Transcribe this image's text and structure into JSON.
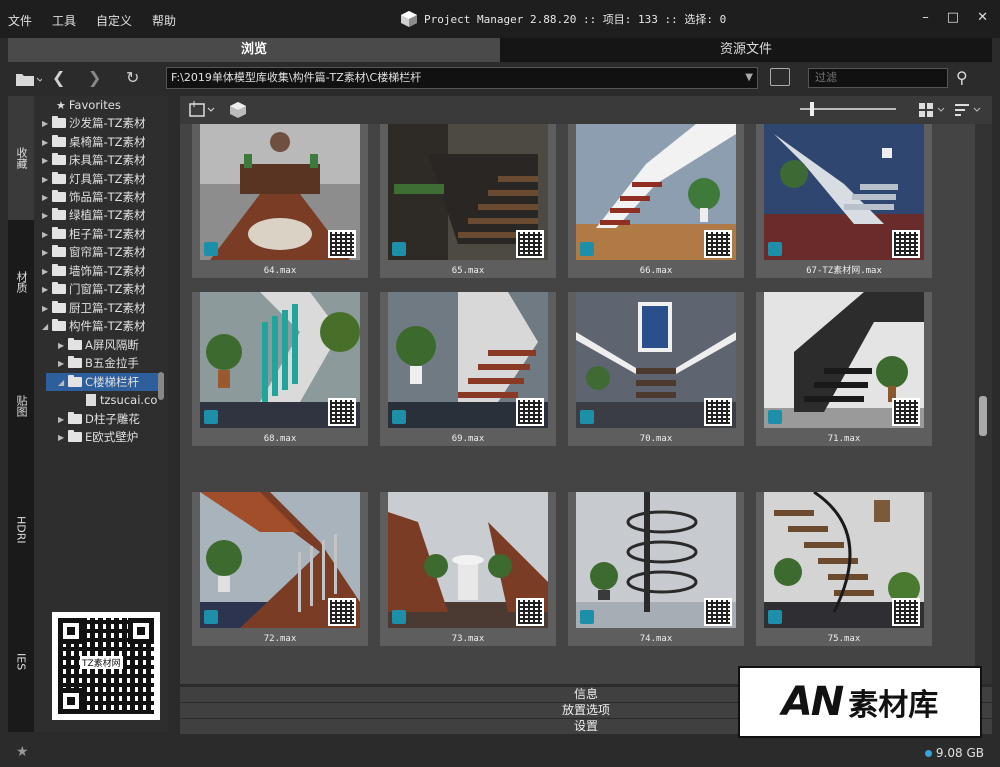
{
  "menu": [
    "文件",
    "工具",
    "自定义",
    "帮助"
  ],
  "app": {
    "title": "Project Manager 2.88.20  :: 项目: 133  :: 选择: 0"
  },
  "window_controls": {
    "minimize": "–",
    "maximize": "□",
    "close": "✕"
  },
  "tabs": [
    {
      "label": "浏览",
      "active": true
    },
    {
      "label": "资源文件",
      "active": false
    }
  ],
  "toolbar": {
    "path": "F:\\2019单体模型库收集\\构件篇-TZ素材\\C楼梯栏杆",
    "filter_placeholder": "过滤"
  },
  "left_tabs": [
    "收藏",
    "材质",
    "贴图",
    "HDRI",
    "IES"
  ],
  "tree": [
    {
      "label": "Favorites",
      "type": "favorites",
      "level": 0
    },
    {
      "label": "沙发篇-TZ素材",
      "type": "folder",
      "level": 0
    },
    {
      "label": "桌椅篇-TZ素材",
      "type": "folder",
      "level": 0
    },
    {
      "label": "床具篇-TZ素材",
      "type": "folder",
      "level": 0
    },
    {
      "label": "灯具篇-TZ素材",
      "type": "folder",
      "level": 0
    },
    {
      "label": "饰品篇-TZ素材",
      "type": "folder",
      "level": 0
    },
    {
      "label": "绿植篇-TZ素材",
      "type": "folder",
      "level": 0
    },
    {
      "label": "柜子篇-TZ素材",
      "type": "folder",
      "level": 0
    },
    {
      "label": "窗帘篇-TZ素材",
      "type": "folder",
      "level": 0
    },
    {
      "label": "墙饰篇-TZ素材",
      "type": "folder",
      "level": 0
    },
    {
      "label": "门窗篇-TZ素材",
      "type": "folder",
      "level": 0
    },
    {
      "label": "厨卫篇-TZ素材",
      "type": "folder",
      "level": 0
    },
    {
      "label": "构件篇-TZ素材",
      "type": "folder",
      "level": 0,
      "expanded": true
    },
    {
      "label": "A屏风隔断",
      "type": "folder",
      "level": 1
    },
    {
      "label": "B五金拉手",
      "type": "folder",
      "level": 1
    },
    {
      "label": "C楼梯栏杆",
      "type": "folder",
      "level": 1,
      "selected": true,
      "expanded": true
    },
    {
      "label": "tzsucai.co",
      "type": "file",
      "level": 2
    },
    {
      "label": "D柱子雕花",
      "type": "folder",
      "level": 1
    },
    {
      "label": "E欧式壁炉",
      "type": "folder",
      "level": 1
    }
  ],
  "qr_caption": "TZ素材网",
  "grid": {
    "items": [
      {
        "label": "64.max",
        "scene": "brick"
      },
      {
        "label": "65.max",
        "scene": "dark"
      },
      {
        "label": "66.max",
        "scene": "white"
      },
      {
        "label": "67-TZ素材网.max",
        "scene": "blue"
      },
      {
        "label": "68.max",
        "scene": "teal"
      },
      {
        "label": "69.max",
        "scene": "wood"
      },
      {
        "label": "70.max",
        "scene": "grey"
      },
      {
        "label": "71.max",
        "scene": "blackrail"
      },
      {
        "label": "72.max",
        "scene": "wood2"
      },
      {
        "label": "73.max",
        "scene": "fountain"
      },
      {
        "label": "74.max",
        "scene": "spiral"
      },
      {
        "label": "75.max",
        "scene": "curved"
      }
    ]
  },
  "panels": [
    "信息",
    "放置选项",
    "设置"
  ],
  "watermark": {
    "prefix": "AN",
    "text": "素材库"
  },
  "status": {
    "disk": "9.08 GB"
  },
  "colors": {
    "selection": "#2e5f9c",
    "max_icon": "#1e8fa8",
    "disk_dot": "#36a3d9"
  }
}
